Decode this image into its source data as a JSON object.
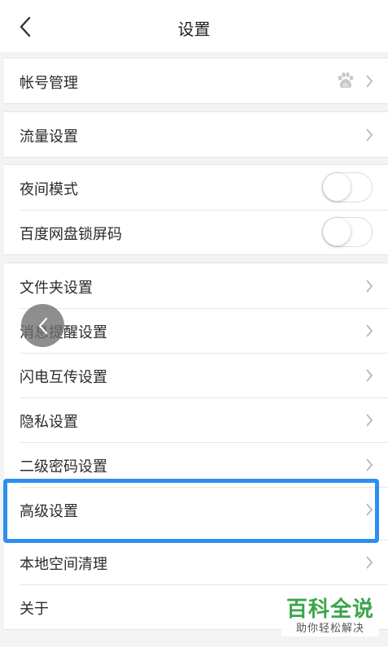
{
  "header": {
    "title": "设置"
  },
  "groups": [
    {
      "rows": [
        {
          "label": "帐号管理",
          "has_baidu_icon": true
        }
      ]
    },
    {
      "rows": [
        {
          "label": "流量设置"
        }
      ]
    },
    {
      "rows": [
        {
          "label": "夜间模式",
          "toggle_on": false
        },
        {
          "label": "百度网盘锁屏码",
          "toggle_on": false
        }
      ]
    },
    {
      "rows": [
        {
          "label": "文件夹设置"
        },
        {
          "label": "消息提醒设置"
        },
        {
          "label": "闪电互传设置"
        },
        {
          "label": "隐私设置"
        },
        {
          "label": "二级密码设置"
        },
        {
          "label": "高级设置",
          "highlighted": true
        },
        {
          "label": "本地空间清理"
        },
        {
          "label": "关于"
        }
      ]
    }
  ],
  "watermark": {
    "main": "百科全说",
    "sub": "助你轻松解决"
  },
  "colors": {
    "highlight": "#2c8ff0",
    "watermark": "#3aa64a"
  },
  "icons": {
    "back": "chevron-left-icon",
    "row": "chevron-right-icon",
    "account": "baidu-paw-icon"
  }
}
